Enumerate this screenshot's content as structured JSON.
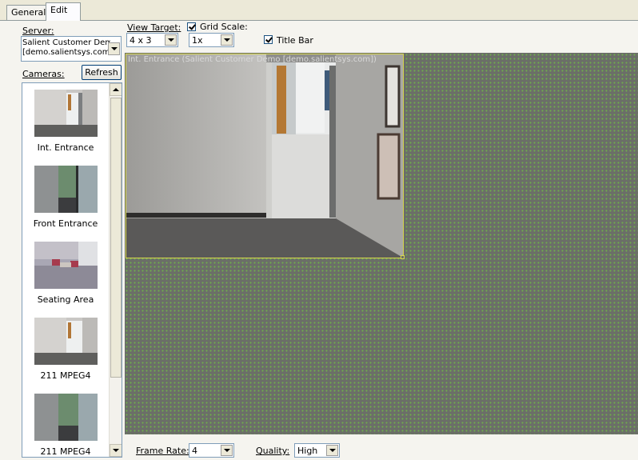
{
  "tabs": [
    {
      "label": "General"
    },
    {
      "label": "Edit"
    }
  ],
  "server": {
    "label": "Server:",
    "value_line1": "Salient Customer Demo",
    "value_line2": "[demo.salientsys.com]"
  },
  "cameras": {
    "label": "Cameras:",
    "refresh_label": "Refresh",
    "items": [
      {
        "label": "Int.  Entrance"
      },
      {
        "label": "Front Entrance"
      },
      {
        "label": "Seating Area"
      },
      {
        "label": "211  MPEG4"
      },
      {
        "label": "211  MPEG4"
      }
    ]
  },
  "view_target": {
    "label": "View Target:",
    "value": "4 x 3"
  },
  "grid_scale": {
    "label": "Grid Scale:",
    "value": "1x",
    "checked": true
  },
  "title_bar": {
    "label": "Title Bar",
    "checked": true
  },
  "tile": {
    "title": "Int.  Entrance (Salient Customer Demo [demo.salientsys.com])"
  },
  "frame_rate": {
    "label": "Frame Rate:",
    "value": "4"
  },
  "quality": {
    "label": "Quality:",
    "value": "High"
  },
  "colors": {
    "canvas": "#6b6e68",
    "grid_dots": "#6fb04b",
    "tile_border": "#d7d64d"
  }
}
